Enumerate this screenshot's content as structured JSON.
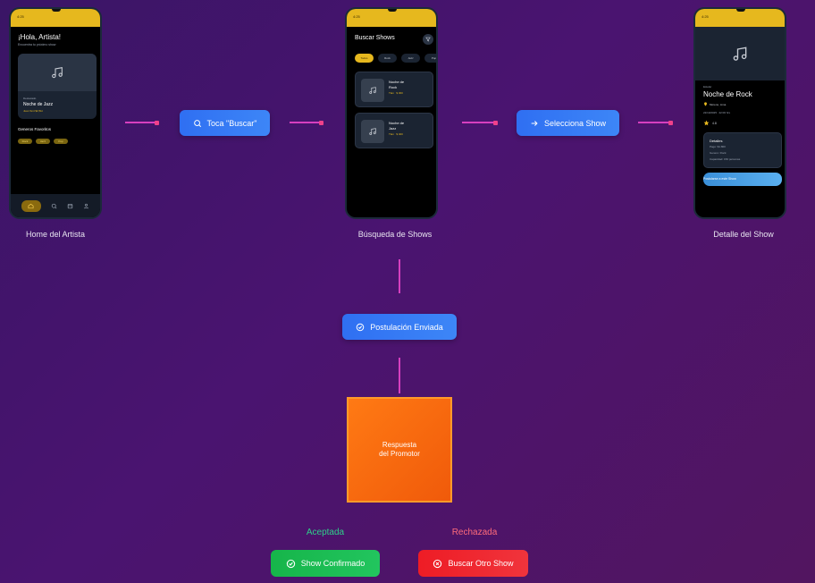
{
  "phones": {
    "home": {
      "time": "4:25",
      "greeting": "¡Hola, Artista!",
      "subtitle": "Encuentra tu próximo show",
      "card_small": "Destacado",
      "card_title": "Noche de Jazz",
      "card_meta": "Juan Smt   $2,5kt",
      "section": "Generos Favoritos",
      "genres": [
        "Rock",
        "Jazz",
        "Pop"
      ],
      "label": "Home del Artista"
    },
    "search": {
      "time": "4:25",
      "title": "Buscar Shows",
      "filters": [
        "Todos",
        "Rock",
        "Jazz",
        "Pop"
      ],
      "results": [
        {
          "title1": "Noche de",
          "title2": "Rock",
          "meta": "Tlan   $ 300"
        },
        {
          "title1": "Noche de",
          "title2": "Jazz",
          "meta": "Tlan   $ 400"
        }
      ],
      "label": "Búsqueda de Shows"
    },
    "detail": {
      "time": "4:25",
      "small": "Estelar",
      "title": "Noche de Rock",
      "location": "Moreno, Lima",
      "date": "22/10/2025   22:00 hrs",
      "rating": "4.8",
      "box_title": "Detalles",
      "box_lines": [
        "Pago: $1.800",
        "Genero: Rock",
        "Capacidad: 150 personas"
      ],
      "apply": "Postularse a este Show",
      "label": "Detalle del Show"
    }
  },
  "steps": {
    "toca": "Toca \"Buscar\"",
    "selecciona": "Selecciona Show",
    "postulacion": "Postulación Enviada"
  },
  "decision": {
    "line1": "Respuesta",
    "line2": "del Promotor"
  },
  "outcomes": {
    "accepted_label": "Aceptada",
    "rejected_label": "Rechazada",
    "accepted_button": "Show Confirmado",
    "rejected_button": "Buscar Otro Show"
  },
  "colors": {
    "accent_yellow": "#e6b81e",
    "step_blue": "#2f6ff2",
    "decision_orange": "#ff7a14",
    "connector": "#d63fbf",
    "accepted": "#1fbf4f",
    "rejected": "#f0242c"
  }
}
